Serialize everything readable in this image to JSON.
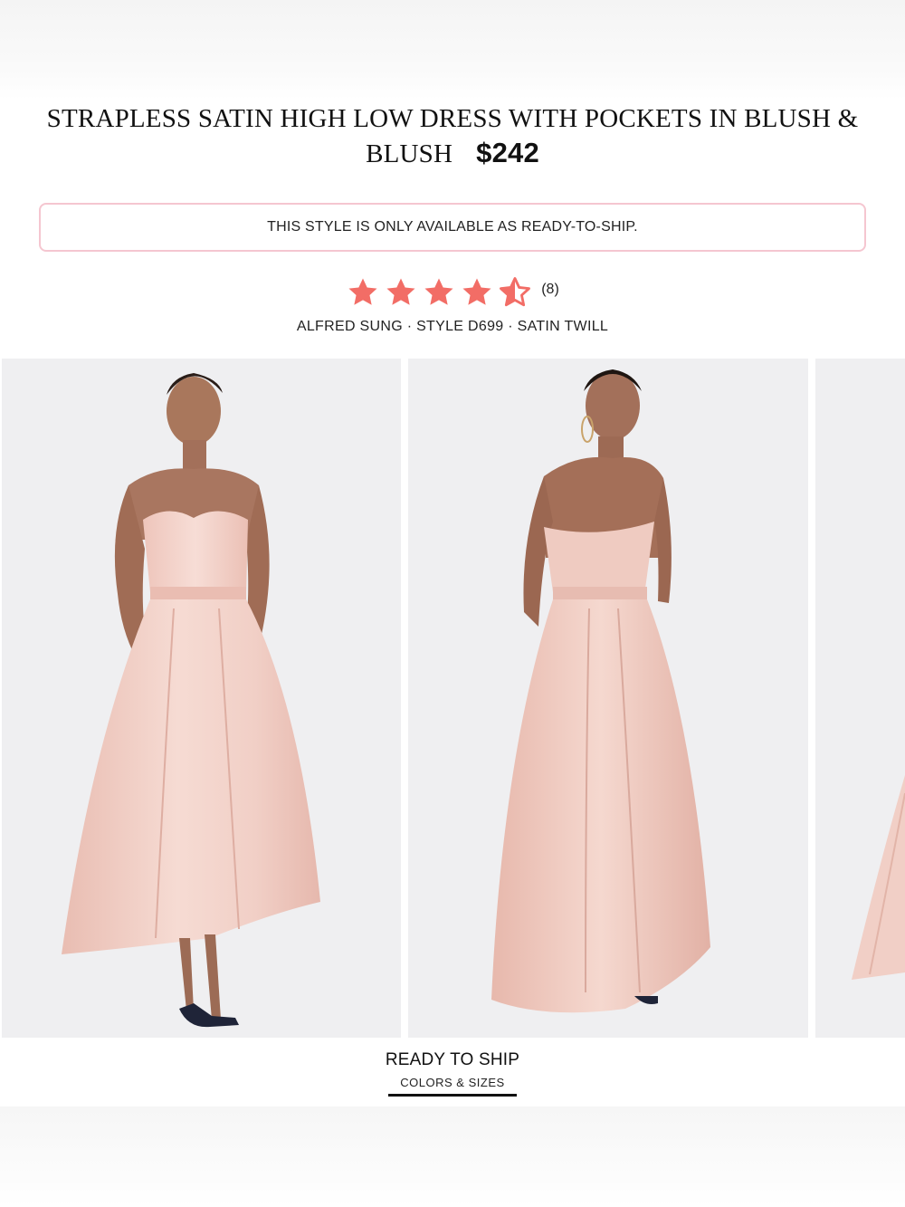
{
  "product": {
    "title": "STRAPLESS SATIN HIGH LOW DRESS WITH POCKETS IN BLUSH & BLUSH",
    "price": "$242"
  },
  "notice": {
    "text": "THIS STYLE IS ONLY AVAILABLE AS READY-TO-SHIP."
  },
  "rating": {
    "value": 4.5,
    "max": 5,
    "count_label": "(8)",
    "star_color": "#f26d66"
  },
  "meta": {
    "line": "ALFRED SUNG · STYLE D699 · SATIN TWILL"
  },
  "gallery": {
    "images": [
      {
        "icon": "dress-front-photo"
      },
      {
        "icon": "dress-back-photo"
      },
      {
        "icon": "dress-side-photo-partial"
      }
    ]
  },
  "tabs": {
    "active_label": "READY TO SHIP",
    "active_sublabel": "COLORS & SIZES"
  },
  "colors": {
    "dress_blush": "#f1cfc6",
    "notice_border": "#f5c6d0"
  }
}
